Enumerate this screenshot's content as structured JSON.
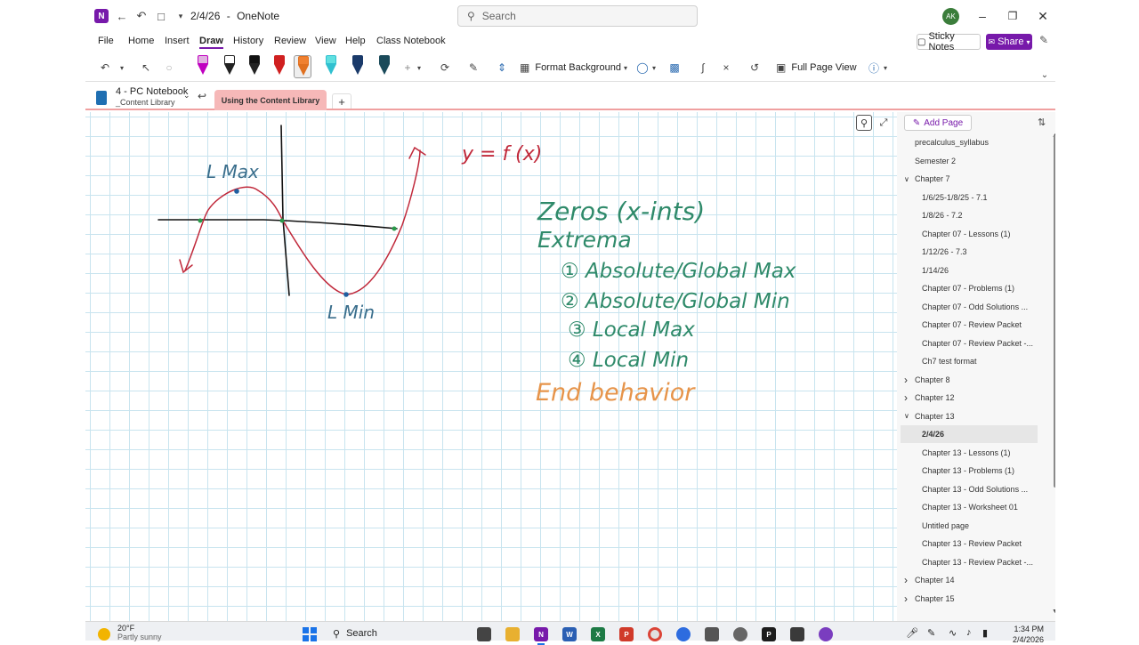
{
  "window": {
    "date_title": "2/4/26",
    "separator": "-",
    "app_name": "OneNote",
    "search_placeholder": "Search",
    "user_initials": "AK"
  },
  "menu": {
    "items": [
      "File",
      "Home",
      "Insert",
      "Draw",
      "History",
      "Review",
      "View",
      "Help",
      "Class Notebook"
    ],
    "active": "Draw",
    "sticky_notes": "Sticky Notes",
    "share": "Share"
  },
  "ribbon": {
    "format_background": "Format Background",
    "full_page_view": "Full Page View",
    "pens": [
      {
        "color": "#c000c0",
        "cap": "#e0b0e0"
      },
      {
        "color": "#222222",
        "cap": "#ffffff"
      },
      {
        "color": "#222222",
        "cap": "#111111"
      },
      {
        "color": "#d02020",
        "cap": "#d02020"
      },
      {
        "color": "#e07020",
        "cap": "#f08030"
      },
      {
        "color": "#30c0d0",
        "cap": "#60e0e0"
      },
      {
        "color": "#1a3a6a",
        "cap": "#1a3a6a"
      },
      {
        "color": "#1a4a5a",
        "cap": "#1a4a5a"
      }
    ],
    "selected_pen": 4
  },
  "notebook": {
    "name": "4 - PC Notebook",
    "section_group": "_Content Library",
    "active_section": "Using the Content Library",
    "add_section": "+"
  },
  "canvas": {
    "equation": "y = f (x)",
    "label_max": "L Max",
    "label_min": "L Min",
    "heading_zeros": "Zeros (x-ints)",
    "heading_extrema": "Extrema",
    "list": [
      "① Absolute/Global Max",
      "② Absolute/Global Min",
      "③ Local Max",
      "④ Local Min"
    ],
    "heading_end": "End behavior",
    "colors": {
      "curve": "#c0283a",
      "axes": "#111111",
      "zero_point": "#2a9a4a",
      "extrema_point": "#1f5fa0",
      "text_blue": "#3a6e8c",
      "text_green": "#2f8a6a",
      "text_orange": "#e6944a"
    }
  },
  "pagelist": {
    "add_page": "Add Page",
    "items": [
      {
        "label": "precalculus_syllabus",
        "level": 1
      },
      {
        "label": "Semester 2",
        "level": 1
      },
      {
        "label": "Chapter 7",
        "level": 1,
        "chevron": "down"
      },
      {
        "label": "1/6/25-1/8/25 - 7.1",
        "level": 2
      },
      {
        "label": "1/8/26 - 7.2",
        "level": 2
      },
      {
        "label": "Chapter 07 - Lessons (1)",
        "level": 2
      },
      {
        "label": "1/12/26 - 7.3",
        "level": 2
      },
      {
        "label": "1/14/26",
        "level": 2
      },
      {
        "label": "Chapter 07 - Problems (1)",
        "level": 2
      },
      {
        "label": "Chapter 07 - Odd Solutions ...",
        "level": 2
      },
      {
        "label": "Chapter 07 - Review Packet",
        "level": 2
      },
      {
        "label": "Chapter 07 - Review Packet -...",
        "level": 2
      },
      {
        "label": "Ch7 test format",
        "level": 2
      },
      {
        "label": "Chapter 8",
        "level": 1,
        "chevron": "right"
      },
      {
        "label": "Chapter 12",
        "level": 1,
        "chevron": "right"
      },
      {
        "label": "Chapter 13",
        "level": 1,
        "chevron": "down"
      },
      {
        "label": "2/4/26",
        "level": 2,
        "selected": true
      },
      {
        "label": "Chapter 13 - Lessons (1)",
        "level": 2
      },
      {
        "label": "Chapter 13 - Problems (1)",
        "level": 2
      },
      {
        "label": "Chapter 13 - Odd Solutions ...",
        "level": 2
      },
      {
        "label": "Chapter 13 - Worksheet 01",
        "level": 2
      },
      {
        "label": "Untitled page",
        "level": 2
      },
      {
        "label": "Chapter 13 - Review Packet",
        "level": 2
      },
      {
        "label": "Chapter 13 - Review Packet -...",
        "level": 2
      },
      {
        "label": "Chapter 14",
        "level": 1,
        "chevron": "right"
      },
      {
        "label": "Chapter 15",
        "level": 1,
        "chevron": "right"
      }
    ]
  },
  "taskbar": {
    "temperature": "20°F",
    "weather": "Partly sunny",
    "search": "Search",
    "time": "1:34 PM",
    "date": "2/4/2026"
  }
}
